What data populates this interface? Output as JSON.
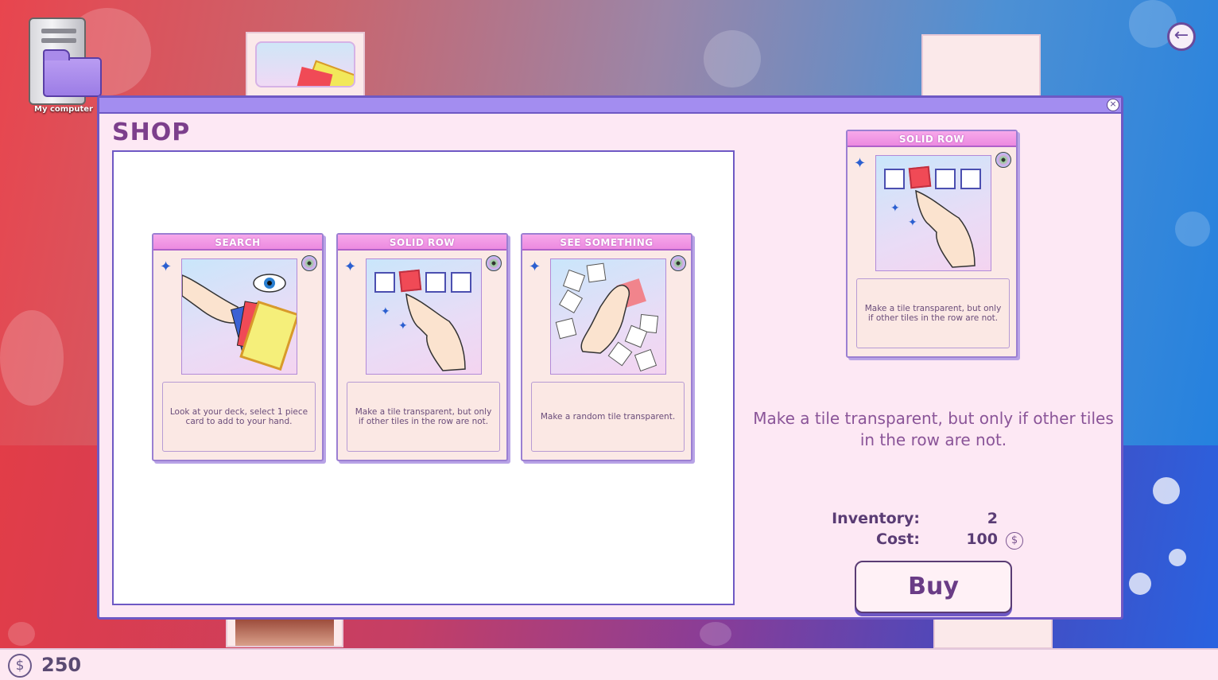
{
  "desktop": {
    "icon_label": "My computer"
  },
  "shop": {
    "title": "SHOP",
    "cards": [
      {
        "name": "SEARCH",
        "description": "Look at your deck, select 1 piece card to add to your hand."
      },
      {
        "name": "SOLID ROW",
        "description": "Make a tile transparent, but only if other tiles in the row are not."
      },
      {
        "name": "SEE SOMETHING",
        "description": "Make a random tile transparent."
      }
    ]
  },
  "detail": {
    "card_name": "SOLID ROW",
    "card_description": "Make a tile transparent, but only if other tiles in the row are not.",
    "long_description": "Make a tile transparent, but only if other tiles in the row are not.",
    "inventory_label": "Inventory:",
    "inventory_value": "2",
    "cost_label": "Cost:",
    "cost_value": "100",
    "buy_label": "Buy"
  },
  "wallet": {
    "balance": "250"
  },
  "icons": {
    "back": "arrow-left-icon",
    "close": "close-icon",
    "currency": "dollar-coin-icon",
    "sparkle": "sparkle-icon",
    "disc": "disc-icon"
  },
  "colors": {
    "window_border": "#6e58c4",
    "title_bar": "#a38df0",
    "card_header": "#ec8ae0",
    "accent_text": "#7c3f8c"
  }
}
